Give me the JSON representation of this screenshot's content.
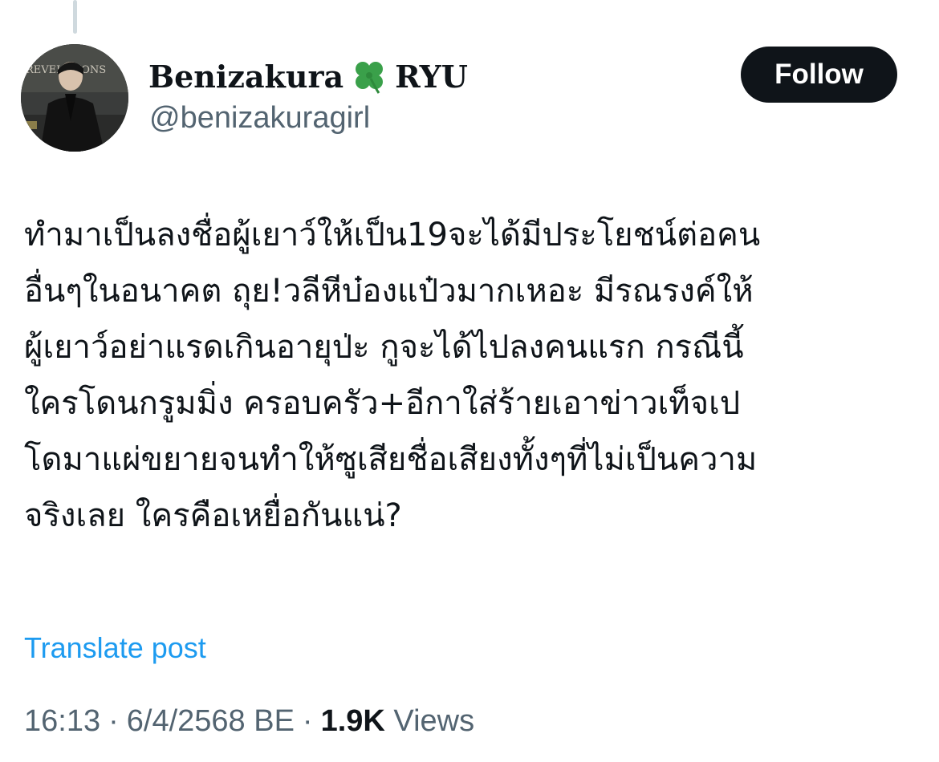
{
  "author": {
    "display_name_part1": "Benizakura",
    "display_name_emoji": "four-leaf-clover-icon",
    "display_name_part2": "RYU",
    "handle": "@benizakuragirl",
    "avatar_text": "REVELATIONS"
  },
  "follow_label": "Follow",
  "post": {
    "lines": [
      "ทำมาเป็นลงชื่อผู้เยาว์ให้เป็น19จะได้มีประโยชน์ต่อคน",
      "อื่นๆในอนาคต ถุย!วลีหีบ๋องแป๋วมากเหอะ มีรณรงค์ให้",
      "ผู้เยาว์อย่าแรดเกินอายุป่ะ กูจะได้ไปลงคนแรก กรณีนี้",
      "ใครโดนกรูมมิ่ง ครอบครัว+อีกาใส่ร้ายเอาข่าวเท็จเป",
      "โดมาแผ่ขยายจนทำให้ซูเสียชื่อเสียงทั้งๆที่ไม่เป็นความ",
      "จริงเลย ใครคือเหยื่อกันแน่?"
    ]
  },
  "translate_label": "Translate post",
  "meta": {
    "time": "16:13",
    "separator": "·",
    "date": "6/4/2568 BE",
    "views_count": "1.9K",
    "views_label": "Views"
  },
  "colors": {
    "text_primary": "#0f1419",
    "text_secondary": "#536471",
    "link": "#1d9bf0",
    "button_bg": "#0f1419",
    "clover": "#3aa04a"
  }
}
